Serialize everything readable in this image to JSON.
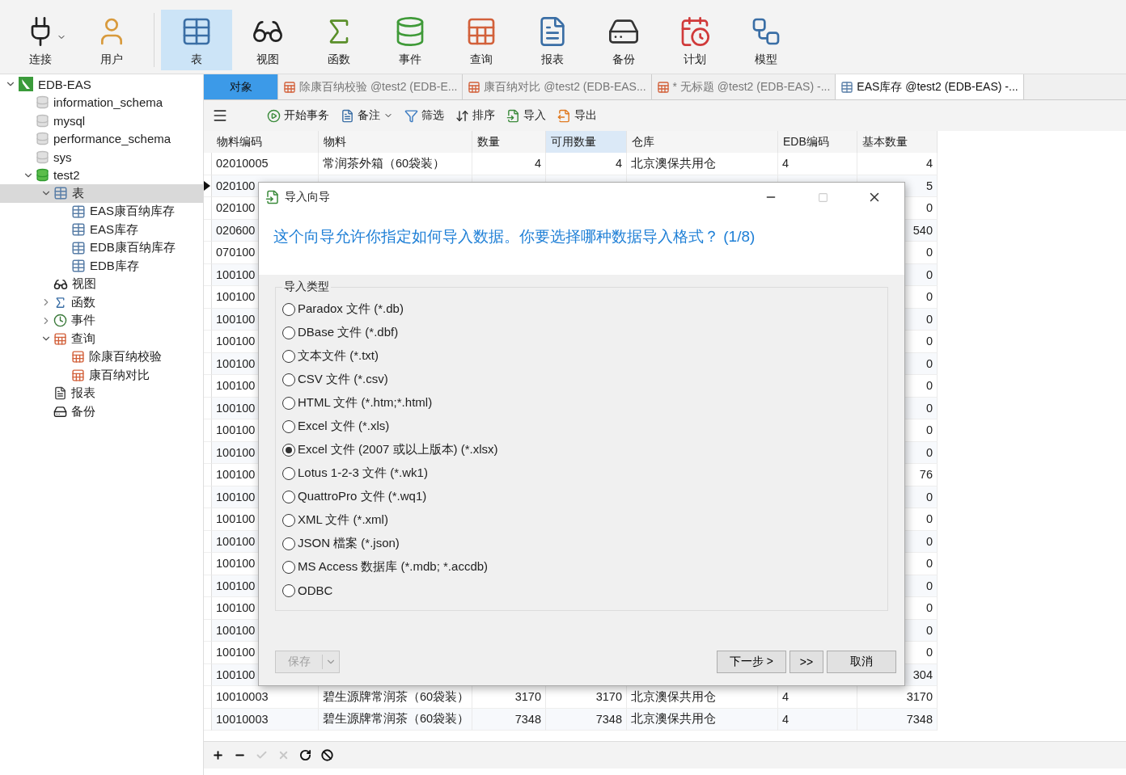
{
  "toolbar": [
    {
      "label": "连接",
      "selected": false,
      "has_menu": true
    },
    {
      "label": "用户",
      "selected": false,
      "has_menu": false
    },
    {
      "label": "表",
      "selected": true,
      "has_menu": false
    },
    {
      "label": "视图",
      "selected": false,
      "has_menu": false
    },
    {
      "label": "函数",
      "selected": false,
      "has_menu": false
    },
    {
      "label": "事件",
      "selected": false,
      "has_menu": false
    },
    {
      "label": "查询",
      "selected": false,
      "has_menu": false
    },
    {
      "label": "报表",
      "selected": false,
      "has_menu": false
    },
    {
      "label": "备份",
      "selected": false,
      "has_menu": false
    },
    {
      "label": "计划",
      "selected": false,
      "has_menu": false
    },
    {
      "label": "模型",
      "selected": false,
      "has_menu": false
    }
  ],
  "sidebar": {
    "items": [
      {
        "label": "EDB-EAS",
        "kind": "connection",
        "expanded": true,
        "selected": false,
        "children": [
          {
            "label": "information_schema",
            "kind": "database",
            "open": false,
            "selected": false
          },
          {
            "label": "mysql",
            "kind": "database",
            "open": false,
            "selected": false
          },
          {
            "label": "performance_schema",
            "kind": "database",
            "open": false,
            "selected": false
          },
          {
            "label": "sys",
            "kind": "database",
            "open": false,
            "selected": false
          },
          {
            "label": "test2",
            "kind": "database",
            "open": true,
            "expanded": true,
            "selected": false,
            "children": [
              {
                "label": "表",
                "kind": "tables",
                "expanded": true,
                "selected": true,
                "children": [
                  {
                    "label": "EAS康百纳库存",
                    "kind": "table",
                    "selected": false
                  },
                  {
                    "label": "EAS库存",
                    "kind": "table",
                    "selected": false
                  },
                  {
                    "label": "EDB康百纳库存",
                    "kind": "table",
                    "selected": false
                  },
                  {
                    "label": "EDB库存",
                    "kind": "table",
                    "selected": false
                  }
                ]
              },
              {
                "label": "视图",
                "kind": "views",
                "selected": false
              },
              {
                "label": "函数",
                "kind": "functions",
                "expanded": false,
                "selected": false
              },
              {
                "label": "事件",
                "kind": "events",
                "expanded": false,
                "selected": false
              },
              {
                "label": "查询",
                "kind": "queries",
                "expanded": true,
                "selected": false,
                "children": [
                  {
                    "label": "除康百纳校验",
                    "kind": "query",
                    "selected": false
                  },
                  {
                    "label": "康百纳对比",
                    "kind": "query",
                    "selected": false
                  }
                ]
              },
              {
                "label": "报表",
                "kind": "reports",
                "selected": false
              },
              {
                "label": "备份",
                "kind": "backups",
                "selected": false
              }
            ]
          }
        ]
      }
    ]
  },
  "tabs": [
    {
      "label": "对象",
      "kind": "objects",
      "selected": false
    },
    {
      "label": "除康百纳校验 @test2 (EDB-E...",
      "kind": "query",
      "selected": false
    },
    {
      "label": "康百纳对比 @test2 (EDB-EAS...",
      "kind": "query",
      "selected": false
    },
    {
      "label": "* 无标题 @test2 (EDB-EAS) -...",
      "kind": "query",
      "selected": false
    },
    {
      "label": "EAS库存 @test2 (EDB-EAS) -...",
      "kind": "table",
      "selected": true
    }
  ],
  "grid_toolbar": [
    {
      "label": "开始事务",
      "has_menu": false
    },
    {
      "label": "备注",
      "has_menu": true
    },
    {
      "label": "筛选",
      "has_menu": false
    },
    {
      "label": "排序",
      "has_menu": false
    },
    {
      "label": "导入",
      "has_menu": false
    },
    {
      "label": "导出",
      "has_menu": false
    }
  ],
  "table": {
    "columns": [
      {
        "label": "物料编码",
        "selected": false
      },
      {
        "label": "物料",
        "selected": false
      },
      {
        "label": "数量",
        "selected": false
      },
      {
        "label": "可用数量",
        "selected": true
      },
      {
        "label": "仓库",
        "selected": false
      },
      {
        "label": "EDB编码",
        "selected": false
      },
      {
        "label": "基本数量",
        "selected": false
      }
    ],
    "rows": [
      {
        "kind": "full",
        "current": false,
        "cells": [
          "02010005",
          "常润茶外箱（60袋装）",
          "4",
          "4",
          "北京澳保共用仓",
          "4",
          "4"
        ]
      },
      {
        "kind": "covered",
        "current": true,
        "code": "020100",
        "base_qty": "5"
      },
      {
        "kind": "covered",
        "current": false,
        "code": "020100",
        "base_qty": "0"
      },
      {
        "kind": "covered",
        "current": false,
        "code": "020600",
        "base_qty": "540"
      },
      {
        "kind": "covered",
        "current": false,
        "code": "070100",
        "base_qty": "0"
      },
      {
        "kind": "covered",
        "current": false,
        "code": "100100",
        "base_qty": "0"
      },
      {
        "kind": "covered",
        "current": false,
        "code": "100100",
        "base_qty": "0"
      },
      {
        "kind": "covered",
        "current": false,
        "code": "100100",
        "base_qty": "0"
      },
      {
        "kind": "covered",
        "current": false,
        "code": "100100",
        "base_qty": "0"
      },
      {
        "kind": "covered",
        "current": false,
        "code": "100100",
        "base_qty": "0"
      },
      {
        "kind": "covered",
        "current": false,
        "code": "100100",
        "base_qty": "0"
      },
      {
        "kind": "covered",
        "current": false,
        "code": "100100",
        "base_qty": "0"
      },
      {
        "kind": "covered",
        "current": false,
        "code": "100100",
        "base_qty": "0"
      },
      {
        "kind": "covered",
        "current": false,
        "code": "100100",
        "base_qty": "0"
      },
      {
        "kind": "covered",
        "current": false,
        "code": "100100",
        "base_qty": "76"
      },
      {
        "kind": "covered",
        "current": false,
        "code": "100100",
        "base_qty": "0"
      },
      {
        "kind": "covered",
        "current": false,
        "code": "100100",
        "base_qty": "0"
      },
      {
        "kind": "covered",
        "current": false,
        "code": "100100",
        "base_qty": "0"
      },
      {
        "kind": "covered",
        "current": false,
        "code": "100100",
        "base_qty": "0"
      },
      {
        "kind": "covered",
        "current": false,
        "code": "100100",
        "base_qty": "0"
      },
      {
        "kind": "covered",
        "current": false,
        "code": "100100",
        "base_qty": "0"
      },
      {
        "kind": "covered",
        "current": false,
        "code": "100100",
        "base_qty": "0"
      },
      {
        "kind": "covered",
        "current": false,
        "code": "100100",
        "base_qty": "0"
      },
      {
        "kind": "covered",
        "current": false,
        "code": "100100",
        "base_qty": "304"
      },
      {
        "kind": "full",
        "current": false,
        "cells": [
          "10010003",
          "碧生源牌常润茶（60袋装）",
          "3170",
          "3170",
          "北京澳保共用仓",
          "4",
          "3170"
        ]
      },
      {
        "kind": "full",
        "current": false,
        "cells": [
          "10010003",
          "碧生源牌常润茶（60袋装）",
          "7348",
          "7348",
          "北京澳保共用仓",
          "4",
          "7348"
        ]
      }
    ]
  },
  "record_bar": [
    {
      "kind": "add",
      "disabled": false
    },
    {
      "kind": "delete",
      "disabled": false
    },
    {
      "kind": "apply",
      "disabled": true
    },
    {
      "kind": "discard",
      "disabled": true
    },
    {
      "kind": "refresh",
      "disabled": false
    },
    {
      "kind": "stop",
      "disabled": false
    }
  ],
  "dialog": {
    "title": "导入向导",
    "heading": "这个向导允许你指定如何导入数据。你要选择哪种数据导入格式？ (1/8)",
    "group_label": "导入类型",
    "options": [
      {
        "label": "Paradox 文件 (*.db)",
        "selected": false
      },
      {
        "label": "DBase 文件 (*.dbf)",
        "selected": false
      },
      {
        "label": "文本文件 (*.txt)",
        "selected": false
      },
      {
        "label": "CSV 文件 (*.csv)",
        "selected": false
      },
      {
        "label": "HTML 文件 (*.htm;*.html)",
        "selected": false
      },
      {
        "label": "Excel 文件 (*.xls)",
        "selected": false
      },
      {
        "label": "Excel 文件 (2007 或以上版本) (*.xlsx)",
        "selected": true
      },
      {
        "label": "Lotus 1-2-3 文件 (*.wk1)",
        "selected": false
      },
      {
        "label": "QuattroPro 文件 (*.wq1)",
        "selected": false
      },
      {
        "label": "XML 文件 (*.xml)",
        "selected": false
      },
      {
        "label": "JSON 檔案 (*.json)",
        "selected": false
      },
      {
        "label": "MS Access 数据库 (*.mdb; *.accdb)",
        "selected": false
      },
      {
        "label": "ODBC",
        "selected": false
      }
    ],
    "save_button": {
      "label": "保存",
      "disabled": true
    },
    "buttons": [
      {
        "label": "下一步 >"
      },
      {
        "label": ">>"
      },
      {
        "label": "取消"
      }
    ]
  }
}
